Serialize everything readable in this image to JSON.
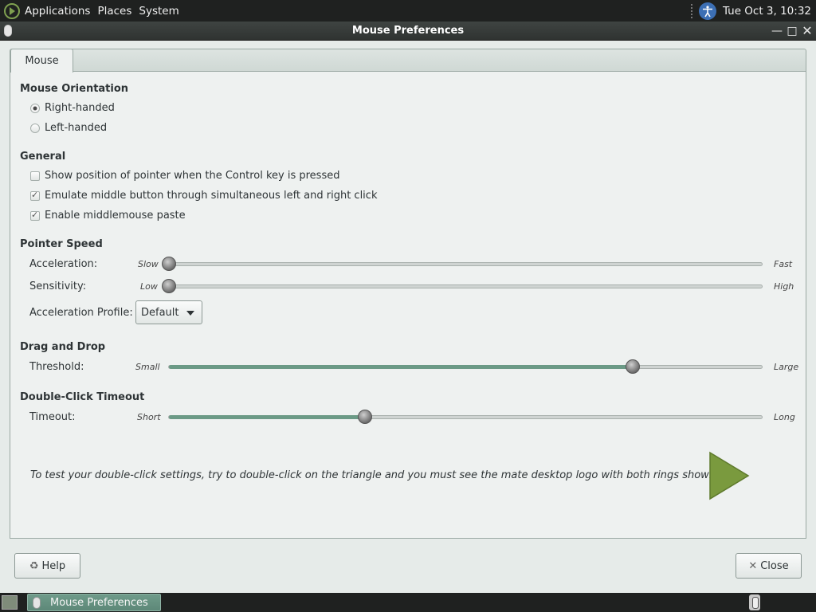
{
  "top_panel": {
    "menus": [
      "Applications",
      "Places",
      "System"
    ],
    "clock": "Tue Oct  3, 10:32"
  },
  "window": {
    "title": "Mouse Preferences",
    "tab": "Mouse"
  },
  "orientation": {
    "title": "Mouse Orientation",
    "right_handed": "Right-handed",
    "left_handed": "Left-handed",
    "selected": "Right-handed"
  },
  "general": {
    "title": "General",
    "show_pointer": "Show position of pointer when the Control key is pressed",
    "show_pointer_checked": false,
    "emulate_middle": "Emulate middle button through simultaneous left and right click",
    "emulate_middle_checked": true,
    "middle_paste": "Enable middlemouse paste",
    "middle_paste_checked": true
  },
  "pointer_speed": {
    "title": "Pointer Speed",
    "acceleration": {
      "label": "Acceleration:",
      "min_label": "Slow",
      "max_label": "Fast",
      "value": 0.0
    },
    "sensitivity": {
      "label": "Sensitivity:",
      "min_label": "Low",
      "max_label": "High",
      "value": 0.0
    },
    "profile_label": "Acceleration Profile:",
    "profile_value": "Default"
  },
  "drag_drop": {
    "title": "Drag and Drop",
    "threshold": {
      "label": "Threshold:",
      "min_label": "Small",
      "max_label": "Large",
      "value": 0.78
    }
  },
  "double_click": {
    "title": "Double-Click Timeout",
    "timeout": {
      "label": "Timeout:",
      "min_label": "Short",
      "max_label": "Long",
      "value": 0.33
    },
    "hint": "To test your double-click settings, try to double-click on the triangle and you must see the mate desktop logo with both rings showing."
  },
  "buttons": {
    "help": "Help",
    "close": "Close"
  },
  "taskbar": {
    "task": "Mouse Preferences"
  },
  "colors": {
    "accent": "#6b9a86",
    "triangle": "#7a9a3e",
    "panel": "#1f2120"
  }
}
